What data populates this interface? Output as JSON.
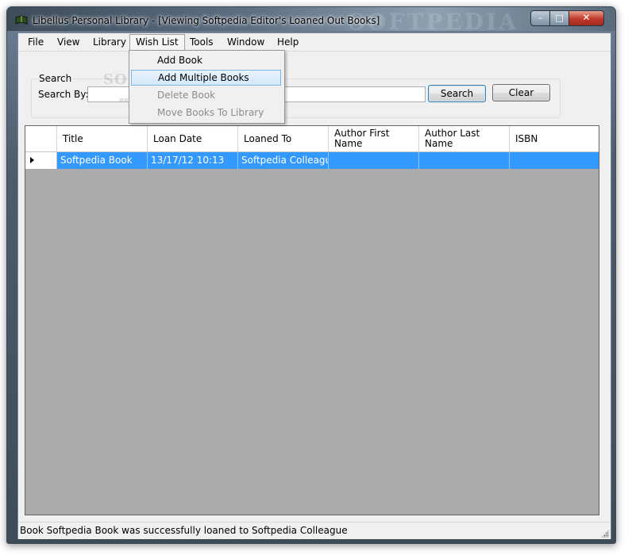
{
  "window": {
    "title": "Libellus Personal Library - [Viewing Softpedia Editor's Loaned Out Books]",
    "watermark": "SOFTPEDIA",
    "minimize_glyph": "–",
    "maximize_glyph": "□",
    "close_glyph": "✕"
  },
  "menubar": {
    "items": [
      "File",
      "View",
      "Library",
      "Wish List",
      "Tools",
      "Window",
      "Help"
    ]
  },
  "wishlist_menu": {
    "items": [
      {
        "label": "Add Book",
        "state": "normal"
      },
      {
        "label": "Add Multiple Books",
        "state": "highlighted"
      },
      {
        "label": "Delete Book",
        "state": "disabled"
      },
      {
        "label": "Move Books To Library",
        "state": "disabled"
      }
    ]
  },
  "search": {
    "group_label": "Search",
    "search_by_label": "Search By:",
    "input_value": "",
    "search_button": "Search",
    "clear_button": "Clear"
  },
  "grid": {
    "columns": [
      "Title",
      "Loan Date",
      "Loaned To",
      "Author First Name",
      "Author Last Name",
      "ISBN"
    ],
    "rows": [
      {
        "title": "Softpedia Book",
        "loan_date": "13/17/12 10:13",
        "loaned_to": "Softpedia Colleague",
        "author_first": "",
        "author_last": "",
        "isbn": "",
        "selected": true
      }
    ]
  },
  "statusbar": {
    "text": "Book Softpedia Book was successfully loaned to Softpedia Colleague"
  },
  "overlay_watermark": {
    "text": "SOFTPEDIA",
    "url": "www.softpedia.com"
  },
  "colors": {
    "selection": "#3399ff",
    "grid_background": "#ababab",
    "menu_highlight_border": "#7fb5e6"
  }
}
